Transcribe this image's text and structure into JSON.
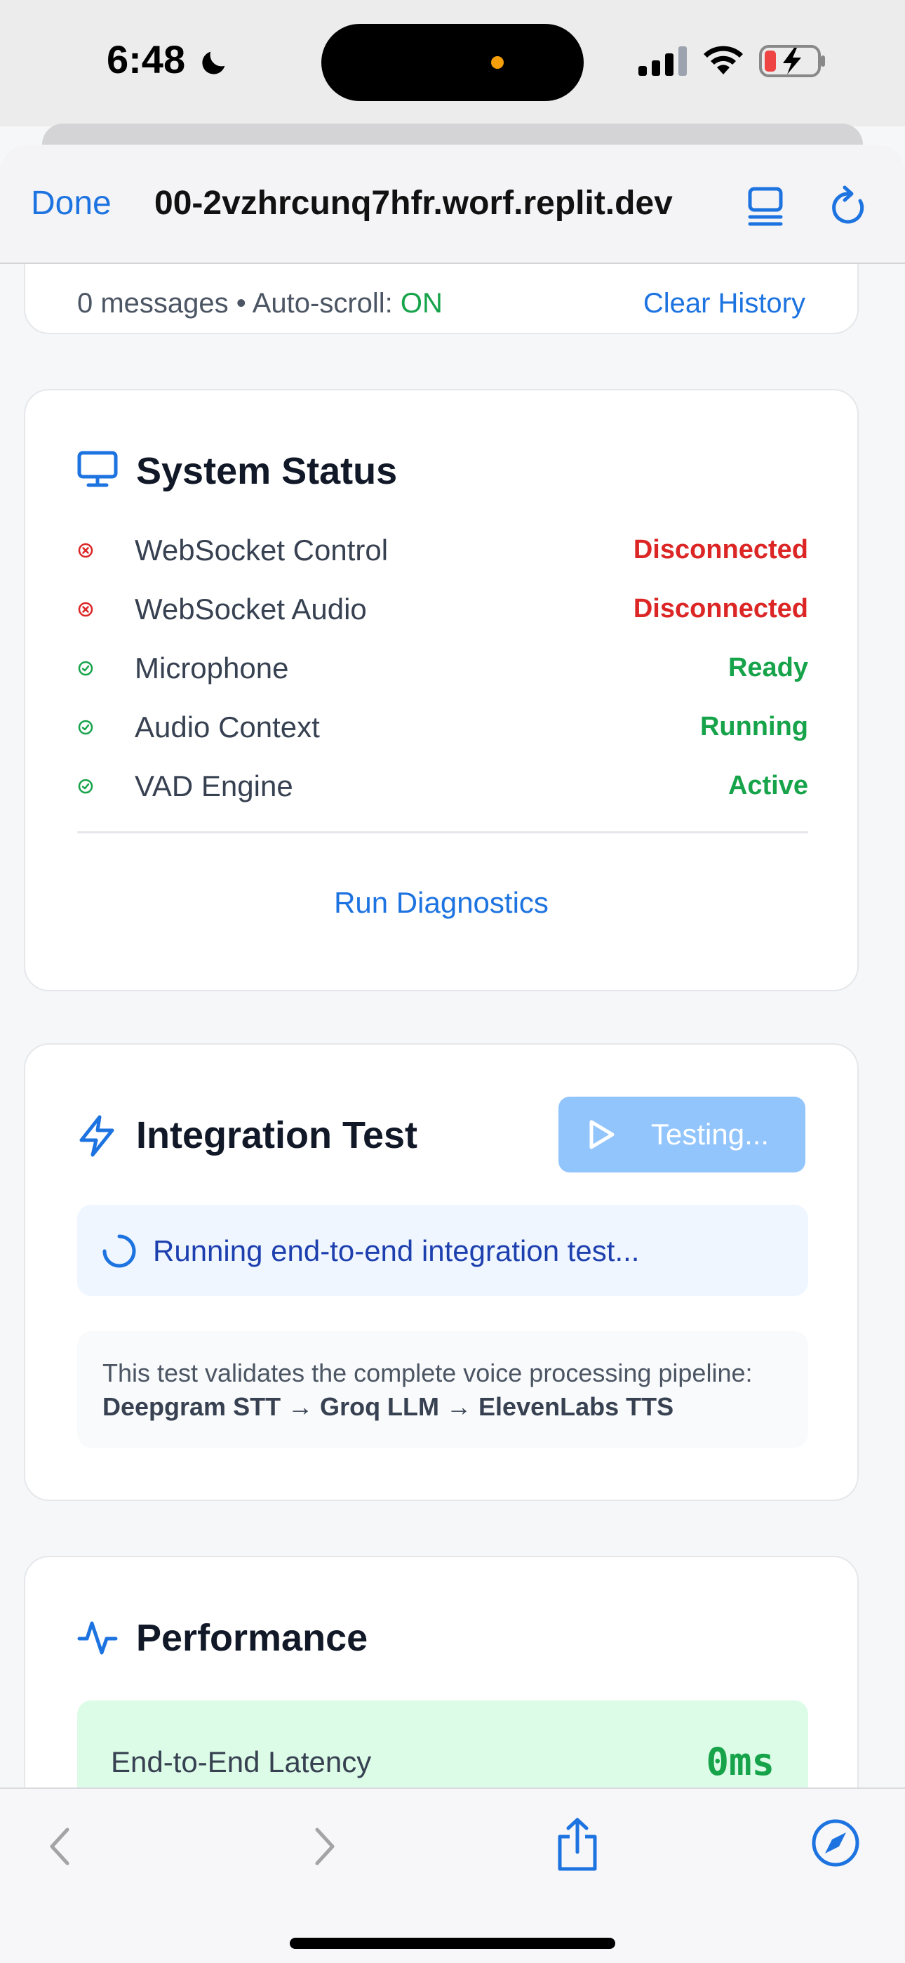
{
  "status_bar": {
    "time": "6:48"
  },
  "browser": {
    "done_label": "Done",
    "url": "00-2vzhrcunq7hfr.worf.replit.dev"
  },
  "messages_bar": {
    "count_text": "0 messages",
    "separator": "•",
    "autoscroll_label": "Auto-scroll:",
    "autoscroll_value": "ON",
    "clear_label": "Clear History"
  },
  "system_status": {
    "title": "System Status",
    "rows": [
      {
        "label": "WebSocket Control",
        "value": "Disconnected",
        "state": "error"
      },
      {
        "label": "WebSocket Audio",
        "value": "Disconnected",
        "state": "error"
      },
      {
        "label": "Microphone",
        "value": "Ready",
        "state": "ok"
      },
      {
        "label": "Audio Context",
        "value": "Running",
        "state": "ok"
      },
      {
        "label": "VAD Engine",
        "value": "Active",
        "state": "ok"
      }
    ],
    "diagnostics_label": "Run Diagnostics"
  },
  "integration_test": {
    "title": "Integration Test",
    "button_label": "Testing...",
    "running_text": "Running end-to-end integration test...",
    "info_prefix": "This test validates the complete voice processing pipeline:",
    "pipeline": "Deepgram STT → Groq LLM → ElevenLabs TTS"
  },
  "performance": {
    "title": "Performance",
    "latency_label": "End-to-End Latency",
    "latency_value": "0ms"
  },
  "colors": {
    "accent": "#1d73e0",
    "error": "#dc2626",
    "success": "#16a34a",
    "button_disabled": "#93c5fd"
  }
}
